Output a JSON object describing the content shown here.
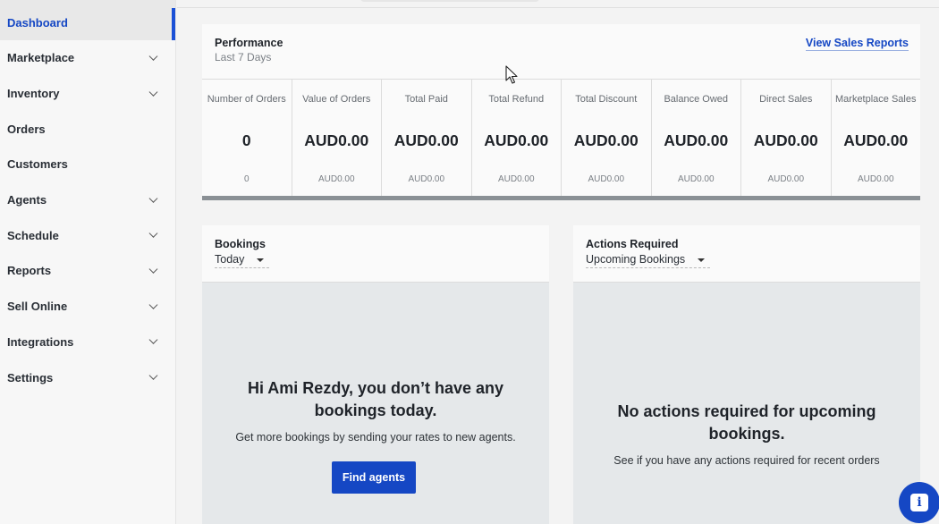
{
  "sidebar": {
    "items": [
      {
        "label": "Dashboard",
        "active": true,
        "expandable": false
      },
      {
        "label": "Marketplace",
        "active": false,
        "expandable": true
      },
      {
        "label": "Inventory",
        "active": false,
        "expandable": true
      },
      {
        "label": "Orders",
        "active": false,
        "expandable": false
      },
      {
        "label": "Customers",
        "active": false,
        "expandable": false
      },
      {
        "label": "Agents",
        "active": false,
        "expandable": true
      },
      {
        "label": "Schedule",
        "active": false,
        "expandable": true
      },
      {
        "label": "Reports",
        "active": false,
        "expandable": true
      },
      {
        "label": "Sell Online",
        "active": false,
        "expandable": true
      },
      {
        "label": "Integrations",
        "active": false,
        "expandable": true
      },
      {
        "label": "Settings",
        "active": false,
        "expandable": true
      }
    ]
  },
  "performance": {
    "title": "Performance",
    "subtitle": "Last 7 Days",
    "link_label": "View Sales Reports",
    "metrics": [
      {
        "label": "Number of Orders",
        "value": "0",
        "sub": "0"
      },
      {
        "label": "Value of Orders",
        "value": "AUD0.00",
        "sub": "AUD0.00"
      },
      {
        "label": "Total Paid",
        "value": "AUD0.00",
        "sub": "AUD0.00"
      },
      {
        "label": "Total Refund",
        "value": "AUD0.00",
        "sub": "AUD0.00"
      },
      {
        "label": "Total Discount",
        "value": "AUD0.00",
        "sub": "AUD0.00"
      },
      {
        "label": "Balance Owed",
        "value": "AUD0.00",
        "sub": "AUD0.00"
      },
      {
        "label": "Direct Sales",
        "value": "AUD0.00",
        "sub": "AUD0.00"
      },
      {
        "label": "Marketplace Sales",
        "value": "AUD0.00",
        "sub": "AUD0.00"
      }
    ]
  },
  "bookings": {
    "title": "Bookings",
    "filter": "Today",
    "empty_title": "Hi Ami Rezdy, you don’t have any bookings today.",
    "empty_desc": "Get more bookings by sending your rates to new agents.",
    "button_label": "Find agents"
  },
  "actions": {
    "title": "Actions Required",
    "filter": "Upcoming Bookings",
    "empty_title": "No actions required for upcoming bookings.",
    "empty_desc": "See if you have any actions required for recent orders"
  },
  "colors": {
    "accent": "#1547c4",
    "sidebar_bg": "#f7f7f7",
    "empty_bg": "#e5e8ea"
  },
  "icons": {
    "expand": "chevron-down-icon",
    "dropdown": "caret-down-icon",
    "cursor": "mouse-pointer-icon",
    "help": "info-icon"
  }
}
